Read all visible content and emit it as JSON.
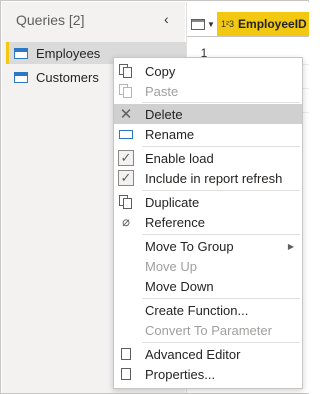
{
  "queries": {
    "title": "Queries [2]",
    "collapse_glyph": "‹",
    "items": [
      {
        "label": "Employees",
        "selected": true,
        "icon": "table-icon"
      },
      {
        "label": "Customers",
        "selected": false,
        "icon": "table-icon"
      }
    ]
  },
  "grid": {
    "column_type": "1²3",
    "column_name": "EmployeeID",
    "row_number": "1",
    "header_color": "#f2c811"
  },
  "menu": {
    "items": [
      {
        "label": "Copy",
        "icon": "copy-icon",
        "disabled": false
      },
      {
        "label": "Paste",
        "icon": "paste-icon",
        "disabled": true
      },
      {
        "label": "Delete",
        "icon": "delete-icon",
        "disabled": false,
        "highlighted": true
      },
      {
        "label": "Rename",
        "icon": "rename-icon",
        "disabled": false
      },
      {
        "label": "Enable load",
        "icon": "checkbox-checked-icon",
        "disabled": false
      },
      {
        "label": "Include in report refresh",
        "icon": "checkbox-checked-icon",
        "disabled": false
      },
      {
        "label": "Duplicate",
        "icon": "duplicate-icon",
        "disabled": false
      },
      {
        "label": "Reference",
        "icon": "reference-icon",
        "disabled": false
      },
      {
        "label": "Move To Group",
        "icon": "",
        "disabled": false,
        "submenu": true
      },
      {
        "label": "Move Up",
        "icon": "",
        "disabled": true
      },
      {
        "label": "Move Down",
        "icon": "",
        "disabled": false
      },
      {
        "label": "Create Function...",
        "icon": "",
        "disabled": false
      },
      {
        "label": "Convert To Parameter",
        "icon": "",
        "disabled": true
      },
      {
        "label": "Advanced Editor",
        "icon": "advanced-editor-icon",
        "disabled": false
      },
      {
        "label": "Properties...",
        "icon": "properties-icon",
        "disabled": false
      }
    ]
  }
}
